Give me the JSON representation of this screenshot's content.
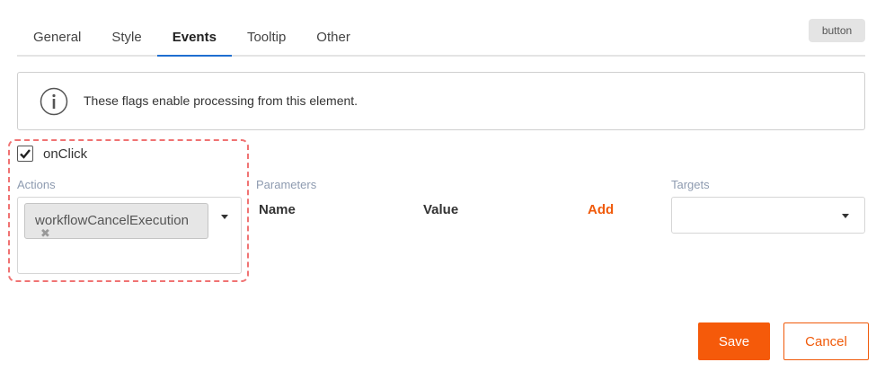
{
  "tabs": [
    {
      "label": "General"
    },
    {
      "label": "Style"
    },
    {
      "label": "Events"
    },
    {
      "label": "Tooltip"
    },
    {
      "label": "Other"
    }
  ],
  "active_tab": "Events",
  "element_type_badge": "button",
  "info": {
    "icon": "info-circle-icon",
    "text": "These flags enable processing from this element."
  },
  "event": {
    "name": "onClick",
    "checked": true,
    "actions_label": "Actions",
    "selected_actions": [
      "workflowCancelExecution"
    ],
    "remove_symbol": "✖",
    "parameters_label": "Parameters",
    "name_header": "Name",
    "value_header": "Value",
    "add_label": "Add",
    "targets_label": "Targets",
    "targets_value": ""
  },
  "footer": {
    "save_label": "Save",
    "cancel_label": "Cancel"
  },
  "colors": {
    "accent": "#f55a0a",
    "active_tab_underline": "#1f6fd1",
    "highlight_border": "#f07373",
    "label": "#8e9bb0"
  }
}
